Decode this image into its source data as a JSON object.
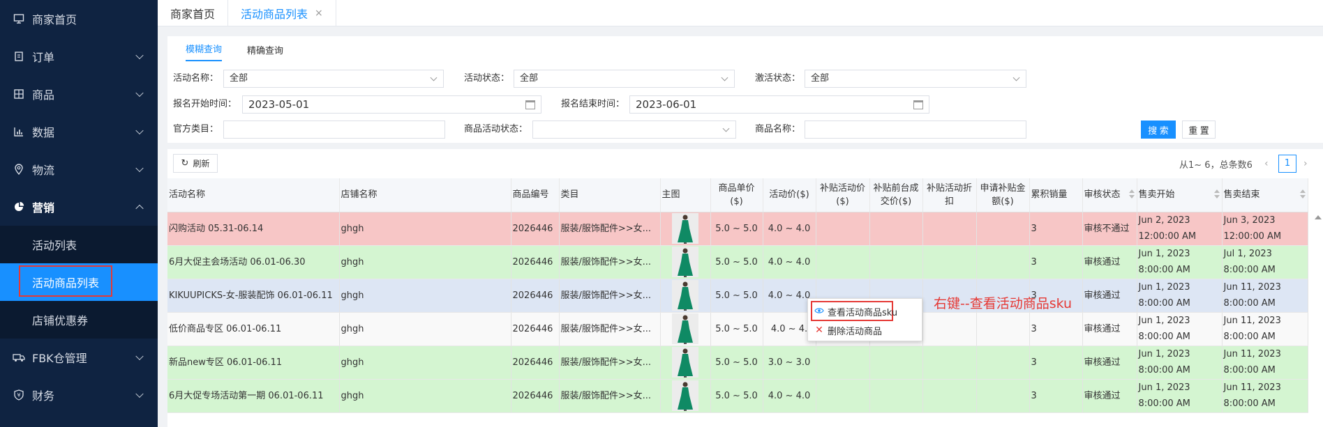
{
  "sidebar": {
    "items": [
      {
        "label": "商家首页",
        "icon": "monitor-icon"
      },
      {
        "label": "订单",
        "icon": "clipboard-icon"
      },
      {
        "label": "商品",
        "icon": "grid-box-icon"
      },
      {
        "label": "数据",
        "icon": "bar-chart-icon"
      },
      {
        "label": "物流",
        "icon": "location-pin-icon"
      },
      {
        "label": "营销",
        "icon": "pie-chart-icon"
      }
    ],
    "sub_items": [
      "活动列表",
      "活动商品列表",
      "店铺优惠券"
    ],
    "bottom_items": [
      {
        "label": "FBK仓管理",
        "icon": "truck-icon"
      },
      {
        "label": "财务",
        "icon": "shield-yen-icon"
      }
    ]
  },
  "tabs": {
    "home": "商家首页",
    "active": "活动商品列表",
    "close": "×"
  },
  "query": {
    "tabs": [
      "模糊查询",
      "精确查询"
    ],
    "activity_name_label": "活动名称：",
    "activity_name_value": "全部",
    "activity_status_label": "活动状态：",
    "activity_status_value": "全部",
    "activation_status_label": "激活状态：",
    "activation_status_value": "全部",
    "signup_start_label": "报名开始时间：",
    "signup_start_value": "2023-05-01",
    "signup_end_label": "报名结束时间：",
    "signup_end_value": "2023-06-01",
    "official_category_label": "官方类目：",
    "official_category_value": "",
    "product_activity_status_label": "商品活动状态：",
    "product_activity_status_value": "",
    "product_name_label": "商品名称：",
    "product_name_value": "",
    "search_button": "搜 索",
    "reset_button": "重 置"
  },
  "toolbar": {
    "refresh": "刷新",
    "pager_summary": "从1~ 6，总条数6",
    "prev": "‹",
    "page": "1",
    "next": "›"
  },
  "table": {
    "headers": [
      "活动名称",
      "店铺名称",
      "商品编号",
      "类目",
      "主图",
      "商品单价($)",
      "活动价($)",
      "补贴活动价($)",
      "补贴前台成交价($)",
      "补贴活动折扣",
      "申请补贴金额($)",
      "累积销量",
      "审核状态",
      "售卖开始",
      "售卖结束"
    ],
    "rows": [
      {
        "name": "闪购活动 05.31-06.14",
        "shop": "ghgh",
        "code": "2026446",
        "category": "服装/服饰配件>>女...",
        "unit_price": "5.0 ~ 5.0",
        "act_price": "4.0 ~ 4.0",
        "sales": "3",
        "audit": "审核不通过",
        "start": "Jun 2, 2023 12:00:00 AM",
        "end": "Jun 3, 2023 12:00:00 AM",
        "color": "red"
      },
      {
        "name": "6月大促主会场活动 06.01-06.30",
        "shop": "ghgh",
        "code": "2026446",
        "category": "服装/服饰配件>>女...",
        "unit_price": "5.0 ~ 5.0",
        "act_price": "4.0 ~ 4.0",
        "sales": "3",
        "audit": "审核通过",
        "start": "Jun 1, 2023 8:00:00 AM",
        "end": "Jul 1, 2023 8:00:00 AM",
        "color": "green"
      },
      {
        "name": "KIKUUPICKS-女-服装配饰 06.01-06.11",
        "shop": "ghgh",
        "code": "2026446",
        "category": "服装/服饰配件>>女...",
        "unit_price": "5.0 ~ 5.0",
        "act_price": "4.0 ~ 4.0",
        "sales": "3",
        "audit": "审核通过",
        "start": "Jun 1, 2023 8:00:00 AM",
        "end": "Jun 11, 2023 8:00:00 AM",
        "color": "blue"
      },
      {
        "name": "低价商品专区 06.01-06.11",
        "shop": "ghgh",
        "code": "2026446",
        "category": "服装/服饰配件>>女...",
        "unit_price": "5.0 ~ 5.0",
        "act_price": "4.0 ~ 4.",
        "sales": "3",
        "audit": "审核通过",
        "start": "Jun 1, 2023 8:00:00 AM",
        "end": "Jun 11, 2023 8:00:00 AM",
        "color": "white"
      },
      {
        "name": "新品new专区 06.01-06.11",
        "shop": "ghgh",
        "code": "2026446",
        "category": "服装/服饰配件>>女...",
        "unit_price": "5.0 ~ 5.0",
        "act_price": "3.0 ~ 3.0",
        "sales": "3",
        "audit": "审核通过",
        "start": "Jun 1, 2023 8:00:00 AM",
        "end": "Jun 11, 2023 8:00:00 AM",
        "color": "green"
      },
      {
        "name": "6月大促专场活动第一期 06.01-06.11",
        "shop": "ghgh",
        "code": "2026446",
        "category": "服装/服饰配件>>女...",
        "unit_price": "5.0 ~ 5.0",
        "act_price": "4.0 ~ 4.0",
        "sales": "3",
        "audit": "审核通过",
        "start": "Jun 1, 2023 8:00:00 AM",
        "end": "Jun 11, 2023 8:00:00 AM",
        "color": "green"
      }
    ]
  },
  "context_menu": {
    "view_sku": "查看活动商品sku",
    "delete": "删除活动商品"
  },
  "annotation": "右键--查看活动商品sku",
  "colors": {
    "sidebar_bg": "#0f2341",
    "accent": "#1890ff",
    "annotation_red": "#e53935"
  }
}
